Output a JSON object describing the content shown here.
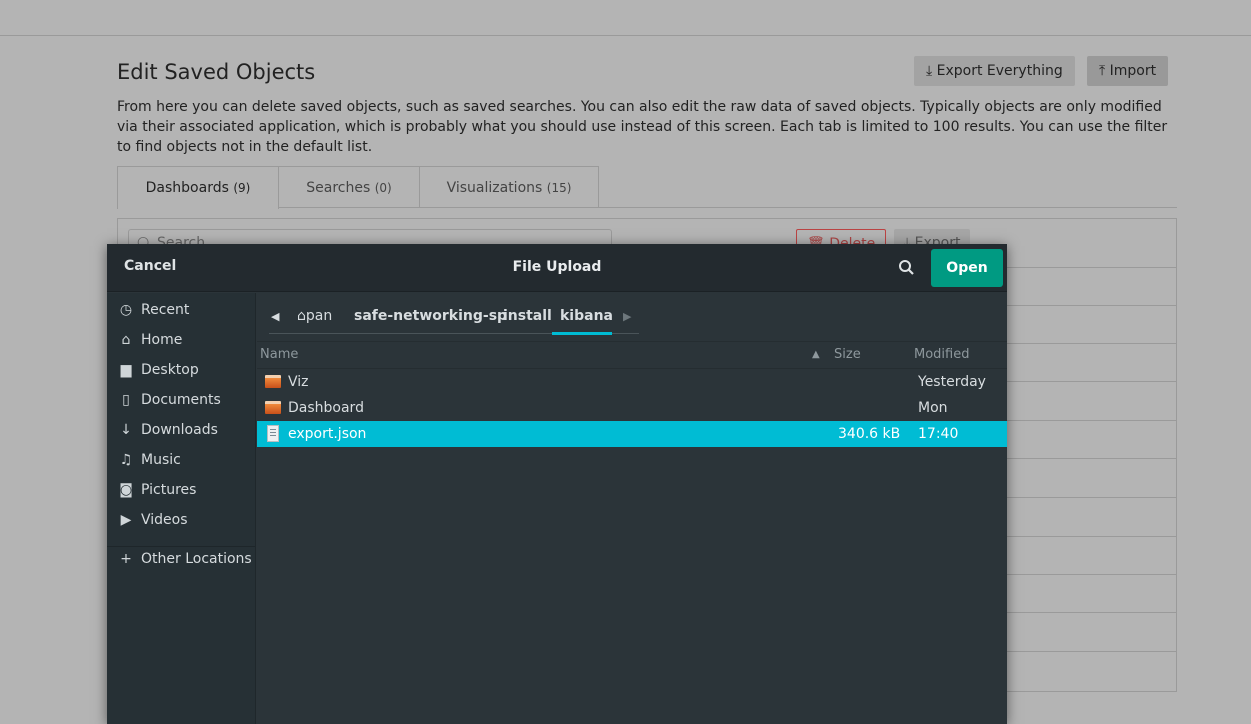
{
  "page": {
    "title": "Edit Saved Objects",
    "export_everything_label": "Export Everything",
    "import_label": "Import",
    "description": "From here you can delete saved objects, such as saved searches. You can also edit the raw data of saved objects. Typically objects are only modified via their associated application, which is probably what you should use instead of this screen. Each tab is limited to 100 results. You can use the filter to find objects not in the default list.",
    "tabs": [
      {
        "label": "Dashboards",
        "count": "(9)"
      },
      {
        "label": "Searches",
        "count": "(0)"
      },
      {
        "label": "Visualizations",
        "count": "(15)"
      }
    ],
    "search_placeholder": "Search",
    "delete_label": "Delete",
    "export_label": "Export"
  },
  "dialog": {
    "cancel_label": "Cancel",
    "title": "File Upload",
    "open_label": "Open",
    "sidebar": [
      {
        "label": "Recent",
        "icon": "clock-icon"
      },
      {
        "label": "Home",
        "icon": "home-icon"
      },
      {
        "label": "Desktop",
        "icon": "folder-icon"
      },
      {
        "label": "Documents",
        "icon": "document-icon"
      },
      {
        "label": "Downloads",
        "icon": "download-icon"
      },
      {
        "label": "Music",
        "icon": "music-icon"
      },
      {
        "label": "Pictures",
        "icon": "camera-icon"
      },
      {
        "label": "Videos",
        "icon": "video-icon"
      }
    ],
    "other_locations_label": "Other Locations",
    "breadcrumb": [
      "pan",
      "safe-networking-sp",
      "install",
      "kibana"
    ],
    "columns": {
      "name": "Name",
      "size": "Size",
      "modified": "Modified"
    },
    "files": [
      {
        "name": "Viz",
        "type": "folder",
        "size": "",
        "modified": "Yesterday"
      },
      {
        "name": "Dashboard",
        "type": "folder",
        "size": "",
        "modified": "Mon"
      },
      {
        "name": "export.json",
        "type": "file",
        "size": "340.6 kB",
        "modified": "17:40",
        "selected": true
      }
    ],
    "accent_color": "#00bcd4",
    "open_color": "#009a82"
  }
}
